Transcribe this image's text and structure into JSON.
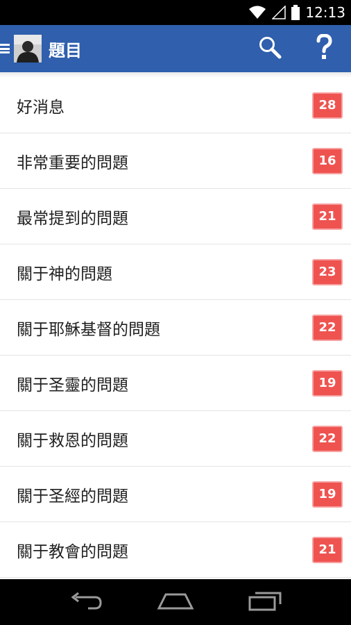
{
  "status_bar": {
    "time": "12:13",
    "icons": [
      "wifi-icon",
      "signal-icon",
      "battery-icon"
    ]
  },
  "app_bar": {
    "title": "題目",
    "icons": [
      "menu-icon",
      "avatar",
      "search-icon",
      "help-icon"
    ]
  },
  "list": {
    "items": [
      {
        "label": "好消息",
        "count": "28"
      },
      {
        "label": "非常重要的問題",
        "count": "16"
      },
      {
        "label": "最常提到的問題",
        "count": "21"
      },
      {
        "label": "關于神的問題",
        "count": "23"
      },
      {
        "label": "關于耶穌基督的問題",
        "count": "22"
      },
      {
        "label": "關于圣靈的問題",
        "count": "19"
      },
      {
        "label": "關于救恩的問題",
        "count": "22"
      },
      {
        "label": "關于圣經的問題",
        "count": "19"
      },
      {
        "label": "關于教會的問題",
        "count": "21"
      }
    ]
  },
  "nav_bar": {
    "icons": [
      "back-icon",
      "home-icon",
      "recents-icon"
    ]
  },
  "colors": {
    "app_bar": "#2f5fad",
    "badge": "#ef5350",
    "status_bar": "#000000"
  }
}
